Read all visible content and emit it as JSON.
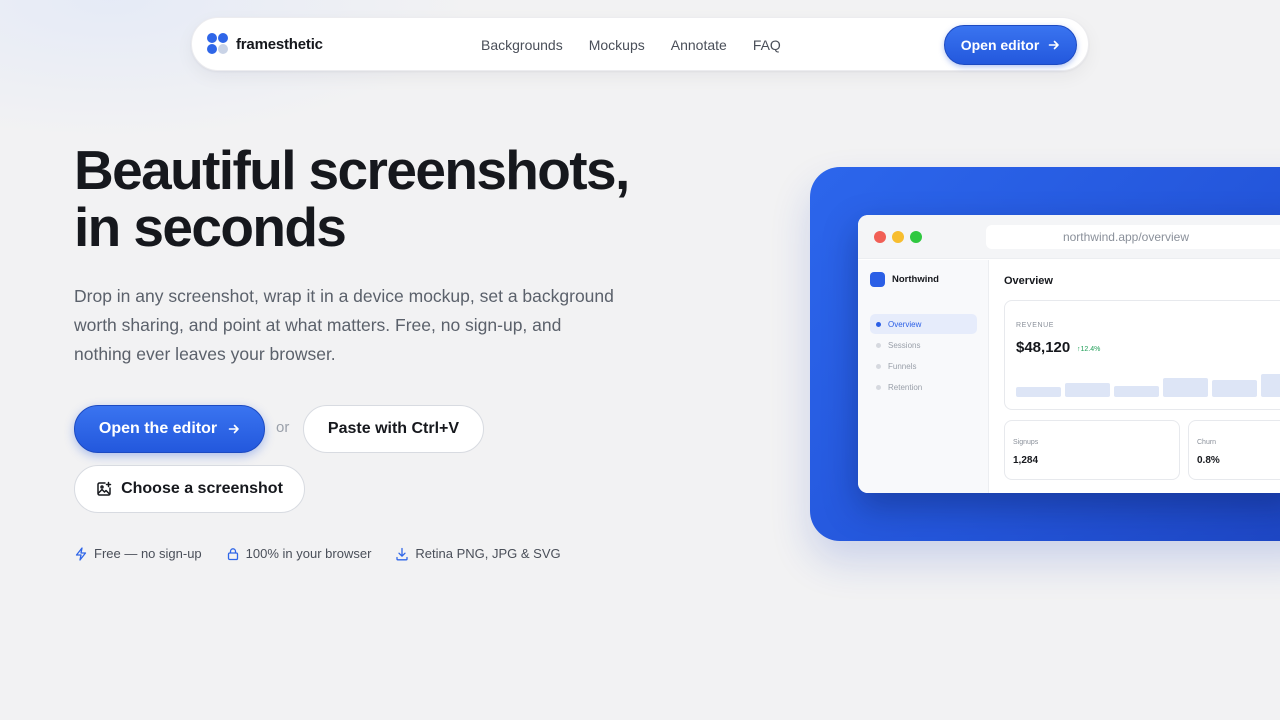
{
  "nav": {
    "brand": "framesthetic",
    "links": [
      "Backgrounds",
      "Mockups",
      "Annotate",
      "FAQ"
    ],
    "cta": "Open editor"
  },
  "hero": {
    "title_line1": "Beautiful screenshots,",
    "title_line2": "in seconds",
    "description": "Drop in any screenshot, wrap it in a device mockup, set a background worth sharing, and point at what matters. Free, no sign-up, and nothing ever leaves your browser.",
    "primary_button": "Open the editor",
    "or_text": "or",
    "paste_button": "Paste with Ctrl+V",
    "choose_button": "Choose a screenshot",
    "features": [
      "Free — no sign-up",
      "100% in your browser",
      "Retina PNG, JPG & SVG"
    ]
  },
  "mockup": {
    "url": "northwind.app/overview",
    "app_name": "Northwind",
    "sidebar": [
      "Overview",
      "Sessions",
      "Funnels",
      "Retention"
    ],
    "active_item": "Overview",
    "page_title": "Overview",
    "revenue_label": "REVENUE",
    "revenue_value": "$48,120",
    "revenue_delta": "↑12.4%",
    "revenue_bars": [
      0.32,
      0.45,
      0.38,
      0.62,
      0.55,
      0.75
    ],
    "stats": [
      {
        "label": "Signups",
        "value": "1,284"
      },
      {
        "label": "Churn",
        "value": "0.8%"
      }
    ]
  },
  "colors": {
    "accent": "#2f66e8",
    "mockup_bg": "#2456db",
    "text": "#16181d",
    "muted": "#5b616b",
    "success": "#22a05a"
  }
}
